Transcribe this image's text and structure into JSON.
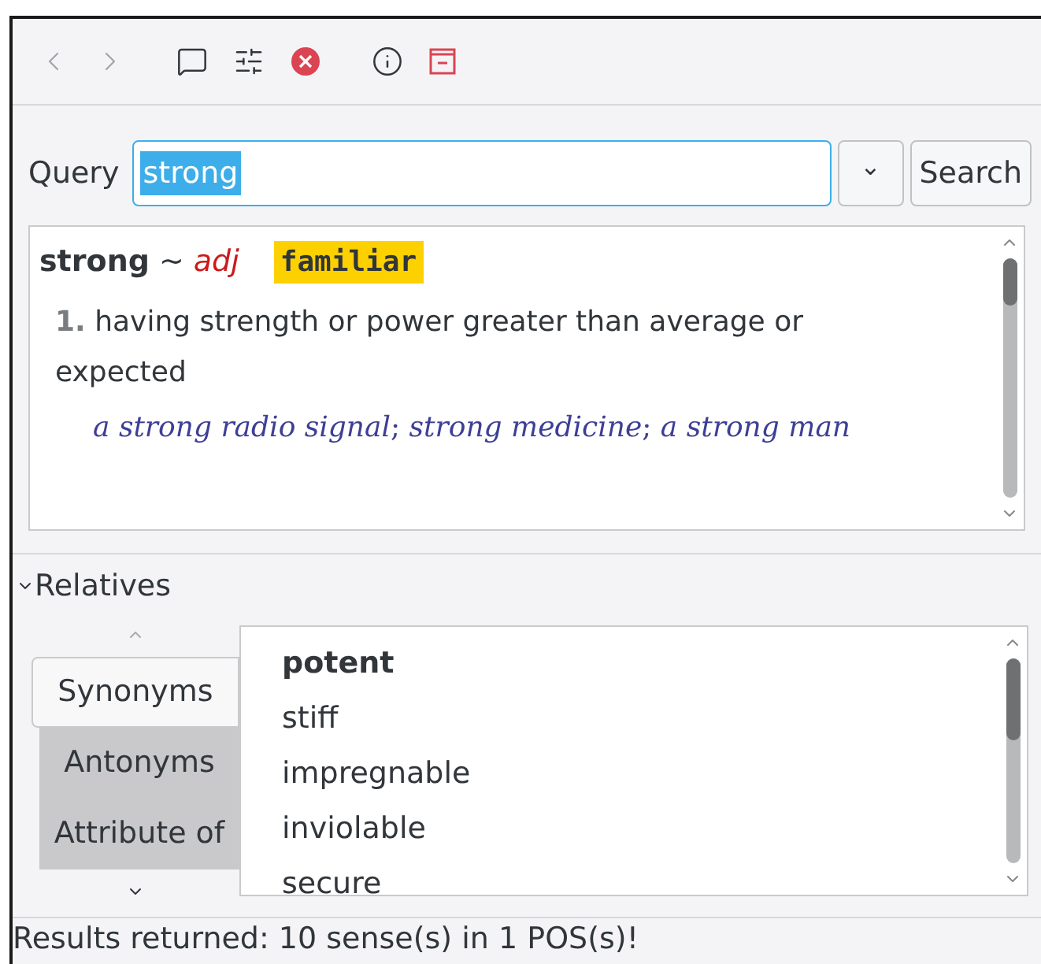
{
  "toolbar": [
    {
      "kind": "back",
      "disabled": true
    },
    {
      "kind": "forward",
      "disabled": true
    },
    {
      "kind": "note"
    },
    {
      "kind": "settings"
    },
    {
      "kind": "close"
    },
    {
      "kind": "info"
    },
    {
      "kind": "minimize"
    }
  ],
  "query": {
    "label": "Query",
    "value": "strong",
    "history_button": "⌄",
    "search_button": "Search"
  },
  "definition": {
    "headword": "strong",
    "tilde": "~",
    "pos": "adj",
    "tag": "familiar",
    "senses": [
      {
        "gloss": "**1.** having strength or power greater than average or expected",
        "examples": "*a strong radio signal*; *strong medicine*; *a strong man*"
      }
    ]
  },
  "relatives": {
    "title": "Relatives",
    "expanded": true,
    "relations": [
      {
        "label": "Synonyms",
        "selected": true
      },
      {
        "label": "Antonyms",
        "selected": false
      },
      {
        "label": "Attribute of",
        "selected": false
      }
    ],
    "words": [
      {
        "text": "potent",
        "kind": "head"
      },
      {
        "text": "stiff",
        "kind": "word"
      },
      {
        "text": "impregnable",
        "kind": "word"
      },
      {
        "text": "inviolable",
        "kind": "word"
      },
      {
        "text": "secure",
        "kind": "word"
      }
    ]
  },
  "status_bar": "Results returned: 10 sense(s) in 1 POS(s)!"
}
